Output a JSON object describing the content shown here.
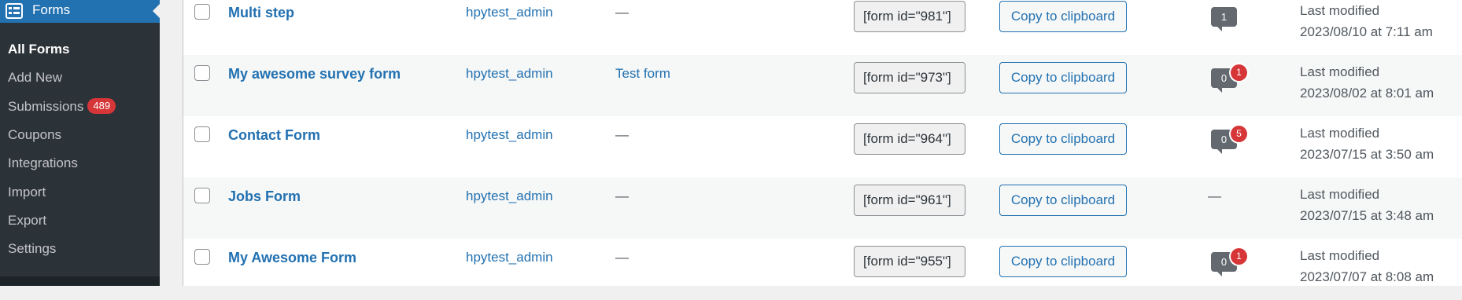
{
  "sidebar": {
    "menu_title": "Forms",
    "menu_icon": "forms-icon",
    "items": [
      {
        "label": "All Forms",
        "current": true
      },
      {
        "label": "Add New"
      },
      {
        "label": "Submissions",
        "badge": "489"
      },
      {
        "label": "Coupons"
      },
      {
        "label": "Integrations"
      },
      {
        "label": "Import"
      },
      {
        "label": "Export"
      },
      {
        "label": "Settings"
      }
    ]
  },
  "colors": {
    "sidebar_bg": "#1d2327",
    "submenu_bg": "#2c3338",
    "accent": "#2271b1",
    "badge": "#d63638",
    "row_alt": "#f6f7f7"
  },
  "forms": [
    {
      "title": "Multi step",
      "author": "hpytest_admin",
      "description": "—",
      "shortcode": "[form id=\"981\"]",
      "copy_label": "Copy to clipboard",
      "comments": "1",
      "pending": "",
      "date_label": "Last modified",
      "date": "2023/08/10 at 7:11 am"
    },
    {
      "title": "My awesome survey form",
      "author": "hpytest_admin",
      "description": "Test form",
      "shortcode": "[form id=\"973\"]",
      "copy_label": "Copy to clipboard",
      "comments": "0",
      "pending": "1",
      "date_label": "Last modified",
      "date": "2023/08/02 at 8:01 am"
    },
    {
      "title": "Contact Form",
      "author": "hpytest_admin",
      "description": "—",
      "shortcode": "[form id=\"964\"]",
      "copy_label": "Copy to clipboard",
      "comments": "0",
      "pending": "5",
      "date_label": "Last modified",
      "date": "2023/07/15 at 3:50 am"
    },
    {
      "title": "Jobs Form",
      "author": "hpytest_admin",
      "description": "—",
      "shortcode": "[form id=\"961\"]",
      "copy_label": "Copy to clipboard",
      "comments": "—",
      "pending": "",
      "date_label": "Last modified",
      "date": "2023/07/15 at 3:48 am"
    },
    {
      "title": "My Awesome Form",
      "author": "hpytest_admin",
      "description": "—",
      "shortcode": "[form id=\"955\"]",
      "copy_label": "Copy to clipboard",
      "comments": "0",
      "pending": "1",
      "date_label": "Last modified",
      "date": "2023/07/07 at 8:08 am"
    }
  ]
}
